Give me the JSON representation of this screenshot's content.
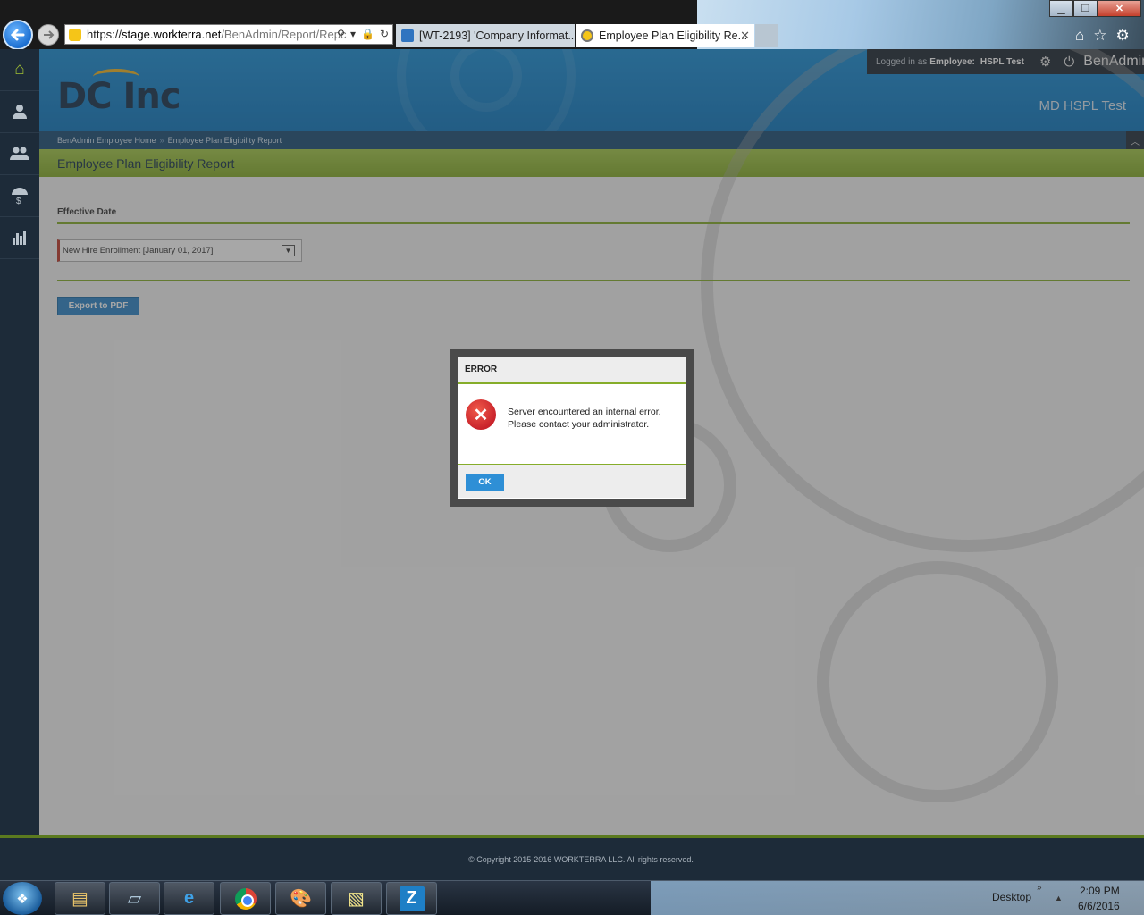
{
  "browser": {
    "url_prefix": "https://",
    "url_host": "stage.workterra.net",
    "url_path": "/BenAdmin/Report/Repc",
    "tabs": [
      {
        "label": "[WT-2193] 'Company Informat...",
        "icon": "jira-icon"
      },
      {
        "label": "Employee Plan Eligibility Re...",
        "icon": "site-favicon"
      }
    ],
    "tools": [
      "home-icon",
      "star-icon",
      "gear-icon"
    ]
  },
  "sidebar": {
    "items": [
      {
        "icon": "home-icon",
        "glyph": "⌂"
      },
      {
        "icon": "user-icon",
        "glyph": "👤"
      },
      {
        "icon": "users-icon",
        "glyph": "👥"
      },
      {
        "icon": "benefits-icon",
        "glyph": "☂"
      },
      {
        "icon": "reports-icon",
        "glyph": "▥"
      }
    ]
  },
  "header": {
    "logo": "DC Inc",
    "company": "MD HSPL Test",
    "user_bar": {
      "prefix": "Logged in as",
      "role": "Employee:",
      "user": "HSPL Test",
      "brand": "BenAdmin"
    }
  },
  "breadcrumb": {
    "items": [
      "BenAdmin Employee Home",
      "Employee Plan Eligibility Report"
    ],
    "separator": "»"
  },
  "page": {
    "title": "Employee Plan Eligibility Report",
    "effective_date_label": "Effective Date",
    "effective_date_value": "New Hire Enrollment [January 01, 2017]",
    "export_button": "Export to PDF"
  },
  "modal": {
    "title": "ERROR",
    "message": "Server encountered an internal error. Please contact your administrator.",
    "ok_label": "OK"
  },
  "footer": {
    "copyright": "© Copyright 2015-2016 WORKTERRA LLC. All rights reserved."
  },
  "taskbar": {
    "desktop_label": "Desktop",
    "time": "2:09 PM",
    "date": "6/6/2016"
  },
  "colors": {
    "header_blue": "#1b8fd7",
    "accent_green": "#86ad2a",
    "button_blue": "#2e86c8",
    "error_red": "#c9232b"
  }
}
